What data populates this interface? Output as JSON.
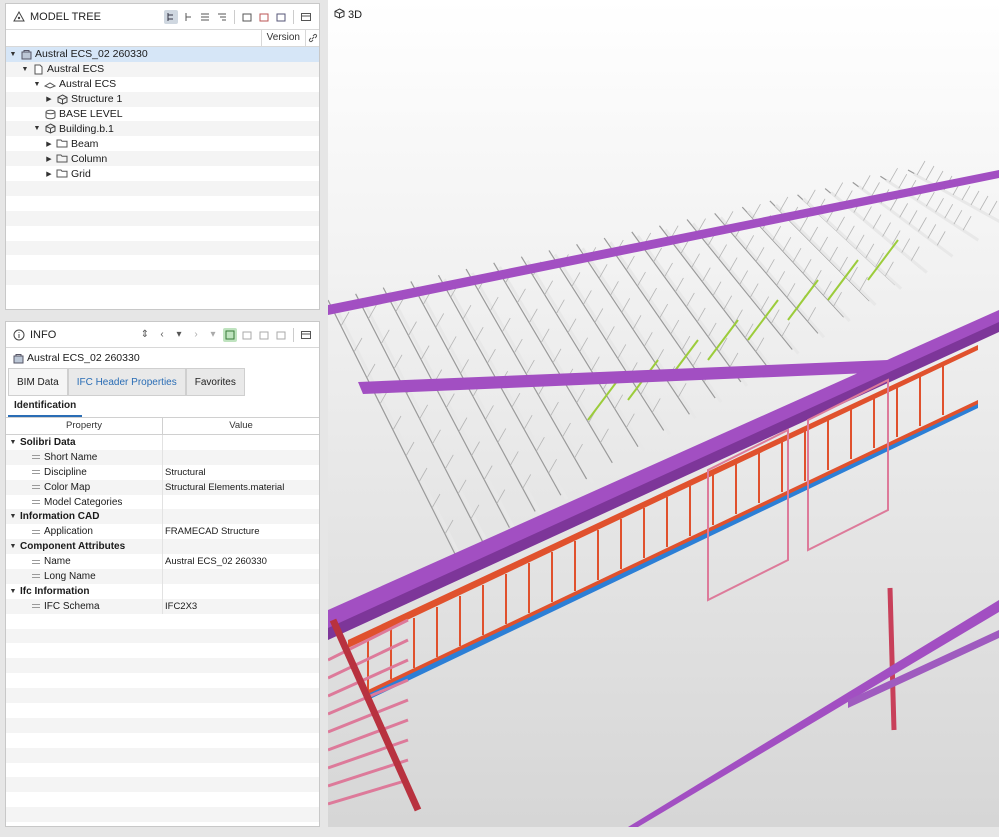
{
  "model_tree": {
    "title": "MODEL TREE",
    "version_header": "Version",
    "rows": [
      {
        "label": "Austral ECS_02 260330",
        "depth": 0,
        "arrow": "down",
        "icon": "model-icon",
        "selected": true
      },
      {
        "label": "Austral ECS",
        "depth": 1,
        "arrow": "down",
        "icon": "document-icon"
      },
      {
        "label": "Austral ECS",
        "depth": 2,
        "arrow": "down",
        "icon": "site-icon"
      },
      {
        "label": "Structure 1",
        "depth": 3,
        "arrow": "right",
        "icon": "cube-icon"
      },
      {
        "label": "BASE LEVEL",
        "depth": 2,
        "arrow": "",
        "icon": "level-icon"
      },
      {
        "label": "Building.b.1",
        "depth": 2,
        "arrow": "down",
        "icon": "cube-icon"
      },
      {
        "label": "Beam",
        "depth": 3,
        "arrow": "right",
        "icon": "folder-icon"
      },
      {
        "label": "Column",
        "depth": 3,
        "arrow": "right",
        "icon": "folder-icon"
      },
      {
        "label": "Grid",
        "depth": 3,
        "arrow": "right",
        "icon": "folder-icon"
      }
    ]
  },
  "info": {
    "title": "INFO",
    "subject": "Austral ECS_02 260330",
    "tabs": [
      {
        "label": "BIM Data",
        "active": true
      },
      {
        "label": "IFC Header Properties",
        "link": true
      },
      {
        "label": "Favorites"
      }
    ],
    "subtab": "Identification",
    "columns": {
      "property": "Property",
      "value": "Value"
    },
    "rows": [
      {
        "type": "group",
        "label": "Solibri Data",
        "value": ""
      },
      {
        "type": "item",
        "label": "Short Name",
        "value": ""
      },
      {
        "type": "item",
        "label": "Discipline",
        "value": "Structural"
      },
      {
        "type": "item",
        "label": "Color Map",
        "value": "Structural Elements.material"
      },
      {
        "type": "item",
        "label": "Model Categories",
        "value": ""
      },
      {
        "type": "group",
        "label": "Information CAD",
        "value": ""
      },
      {
        "type": "item",
        "label": "Application",
        "value": "FRAMECAD Structure"
      },
      {
        "type": "group",
        "label": "Component Attributes",
        "value": ""
      },
      {
        "type": "item",
        "label": "Name",
        "value": "Austral ECS_02 260330"
      },
      {
        "type": "item",
        "label": "Long Name",
        "value": ""
      },
      {
        "type": "group",
        "label": "Ifc Information",
        "value": ""
      },
      {
        "type": "item",
        "label": "IFC Schema",
        "value": "IFC2X3"
      }
    ]
  },
  "viewport": {
    "label": "3D",
    "colors": {
      "background": "#e5e5e5",
      "purple": "#a24fc2",
      "orange": "#e0512d",
      "pink": "#dd7a9a",
      "blue": "#2c7fd6",
      "truss": "#e8e8e8",
      "green": "#9ccc3b"
    }
  }
}
